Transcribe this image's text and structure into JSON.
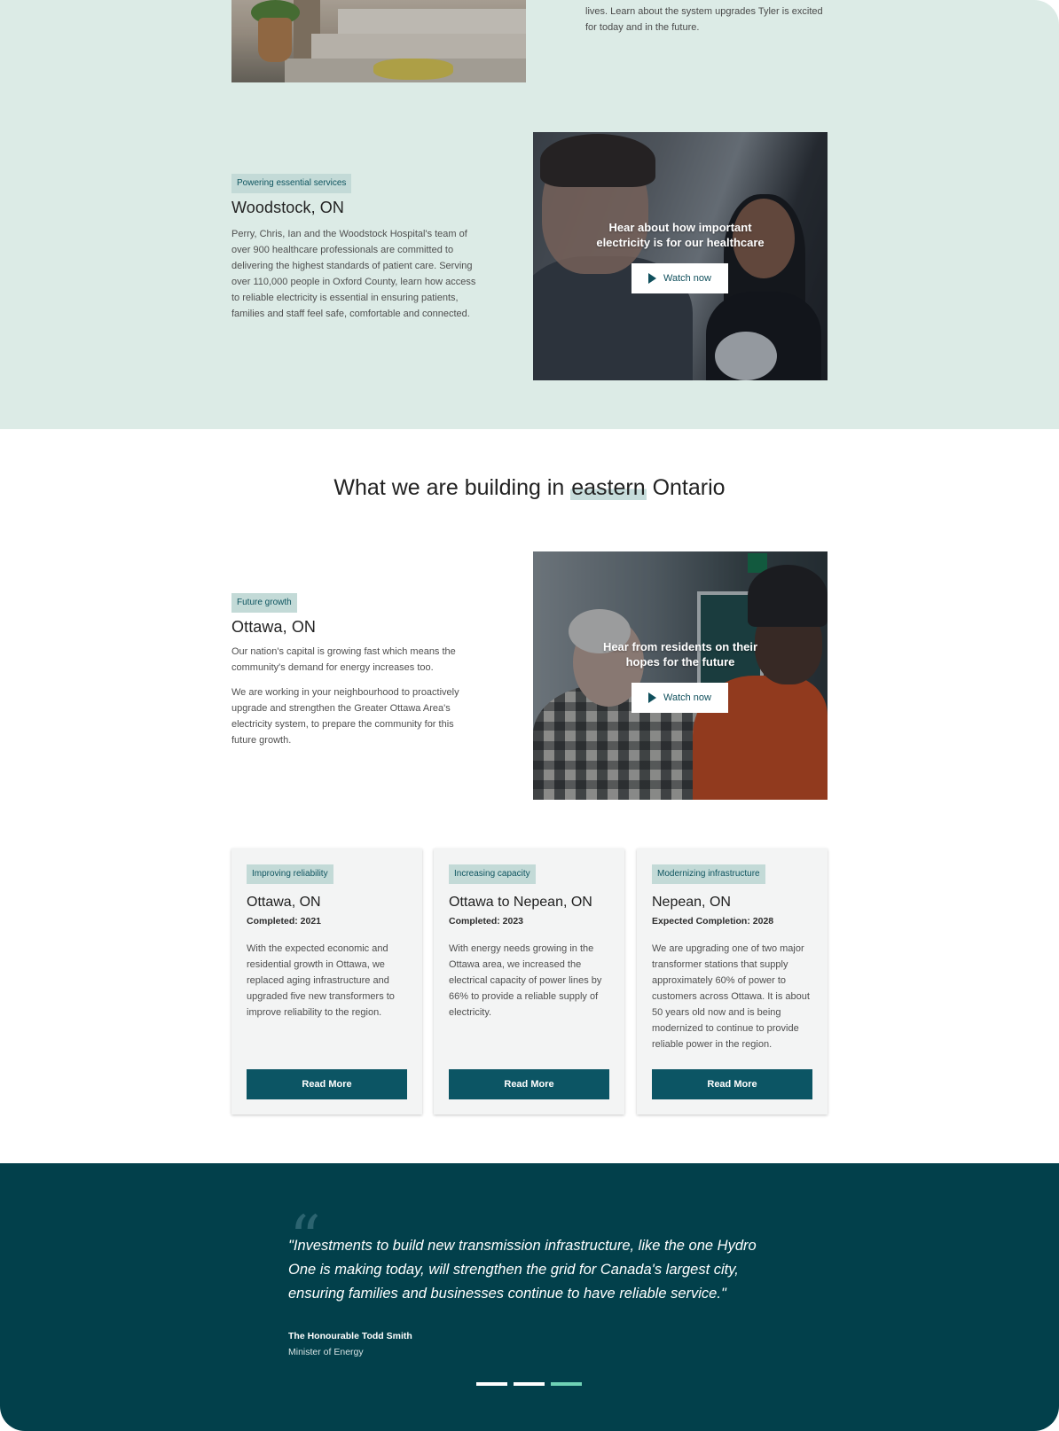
{
  "top_story": {
    "text": "lives. Learn about the system upgrades Tyler is excited for today and in the future."
  },
  "woodstock": {
    "tag": "Powering essential services",
    "title": "Woodstock, ON",
    "body": "Perry, Chris, Ian and the Woodstock Hospital's team of over 900 healthcare professionals are committed to delivering the highest standards of patient care. Serving over 110,000 people in Oxford County, learn how access to reliable electricity is essential in ensuring patients, families and staff feel safe, comfortable and connected.",
    "video_title": "Hear about how important electricity is for our healthcare",
    "watch_label": "Watch now"
  },
  "eastern": {
    "heading_pre": "What we are building in ",
    "heading_highlight": "eastern",
    "heading_post": " Ontario"
  },
  "ottawa": {
    "tag": "Future growth",
    "title": "Ottawa, ON",
    "p1": "Our nation's capital is growing fast which means the community's demand for energy increases too.",
    "p2": "We are working in your neighbourhood to proactively upgrade and strengthen the Greater Ottawa Area's electricity system, to prepare the community for this future growth.",
    "video_title": "Hear from residents on their hopes for the future",
    "watch_label": "Watch now"
  },
  "cards": [
    {
      "tag": "Improving reliability",
      "title": "Ottawa, ON",
      "status": "Completed: 2021",
      "body": "With the expected economic and residential growth in Ottawa, we replaced aging infrastructure and upgraded five new transformers to improve reliability to the region.",
      "button": "Read More"
    },
    {
      "tag": "Increasing capacity",
      "title": "Ottawa to Nepean, ON",
      "status": "Completed: 2023",
      "body": "With energy needs growing in the Ottawa area, we increased the electrical capacity of power lines by 66% to provide a reliable supply of electricity.",
      "button": "Read More"
    },
    {
      "tag": "Modernizing infrastructure",
      "title": "Nepean, ON",
      "status": "Expected Completion: 2028",
      "body": "We are upgrading one of two major transformer stations that supply approximately 60% of power to customers across Ottawa. It is about 50 years old now and is being modernized to continue to provide reliable power in the region.",
      "button": "Read More"
    }
  ],
  "quote": {
    "mark": "“",
    "text": "\"Investments to build new transmission infrastructure, like the one Hydro One is making today, will strengthen the grid for Canada's largest city, ensuring families and businesses continue to have reliable service.\"",
    "author": "The Honourable Todd Smith",
    "role": "Minister of Energy",
    "slides": 3,
    "active_slide": 3
  },
  "colors": {
    "mint_bg": "#dcebe6",
    "tag_bg": "#c3dad7",
    "primary": "#0c5564",
    "quote_bg": "#02404b",
    "accent": "#6fd2b5"
  },
  "icons": {
    "play": "play-icon",
    "quote": "quote-mark-icon"
  }
}
